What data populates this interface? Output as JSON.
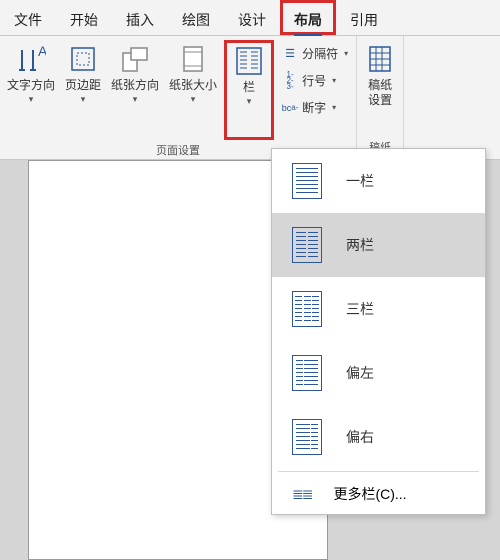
{
  "tabs": {
    "file": "文件",
    "home": "开始",
    "insert": "插入",
    "draw": "绘图",
    "design": "设计",
    "layout": "布局",
    "ref": "引用"
  },
  "ribbon": {
    "textdir": "文字方向",
    "margins": "页边距",
    "orient": "纸张方向",
    "size": "纸张大小",
    "columns": "栏",
    "breaks": "分隔符",
    "linenum": "行号",
    "hyphen": "断字",
    "group_page": "页面设置",
    "grid_set": "稿纸\n设置",
    "group_grid": "稿纸"
  },
  "dropdown": {
    "one": "一栏",
    "two": "两栏",
    "three": "三栏",
    "left": "偏左",
    "right": "偏右",
    "more": "更多栏(C)..."
  }
}
